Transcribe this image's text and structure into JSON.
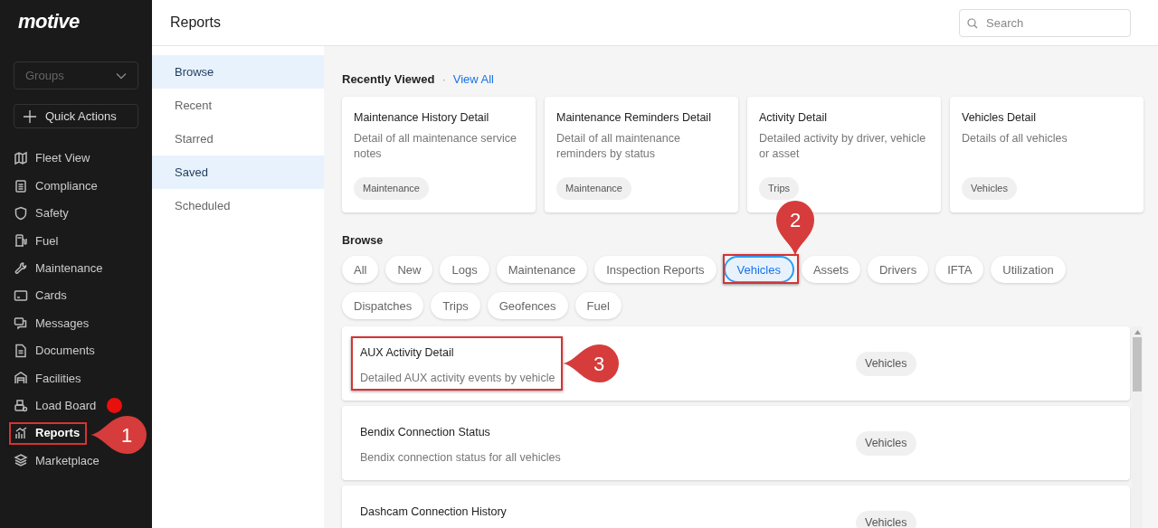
{
  "sidebar": {
    "logo": "motive",
    "groups": {
      "placeholder": "Groups"
    },
    "quick_actions": "Quick Actions",
    "items": [
      {
        "label": "Fleet View",
        "selected": false,
        "badge": false
      },
      {
        "label": "Compliance",
        "selected": false,
        "badge": false
      },
      {
        "label": "Safety",
        "selected": false,
        "badge": false
      },
      {
        "label": "Fuel",
        "selected": false,
        "badge": false
      },
      {
        "label": "Maintenance",
        "selected": false,
        "badge": false
      },
      {
        "label": "Cards",
        "selected": false,
        "badge": false
      },
      {
        "label": "Messages",
        "selected": false,
        "badge": false
      },
      {
        "label": "Documents",
        "selected": false,
        "badge": false
      },
      {
        "label": "Facilities",
        "selected": false,
        "badge": false
      },
      {
        "label": "Load Board",
        "selected": false,
        "badge": true
      },
      {
        "label": "Reports",
        "selected": true,
        "badge": false
      },
      {
        "label": "Marketplace",
        "selected": false,
        "badge": false
      }
    ]
  },
  "header": {
    "title": "Reports",
    "search": {
      "placeholder": "Search"
    }
  },
  "subnav": [
    {
      "label": "Browse",
      "selected": true
    },
    {
      "label": "Recent",
      "selected": false
    },
    {
      "label": "Starred",
      "selected": false
    },
    {
      "label": "Saved",
      "selected": true
    },
    {
      "label": "Scheduled",
      "selected": false
    }
  ],
  "recently_viewed": {
    "title": "Recently Viewed",
    "separator": "·",
    "link": "View All",
    "cards": [
      {
        "title": "Maintenance History Detail",
        "description": "Detail of all maintenance service notes",
        "tag": "Maintenance"
      },
      {
        "title": "Maintenance Reminders Detail",
        "description": "Detail of all maintenance reminders by status",
        "tag": "Maintenance"
      },
      {
        "title": "Activity Detail",
        "description": "Detailed activity by driver, vehicle or asset",
        "tag": "Trips"
      },
      {
        "title": "Vehicles Detail",
        "description": "Details of all vehicles",
        "tag": "Vehicles"
      }
    ]
  },
  "browse": {
    "title": "Browse",
    "filters": [
      {
        "label": "All",
        "selected": false
      },
      {
        "label": "New",
        "selected": false
      },
      {
        "label": "Logs",
        "selected": false
      },
      {
        "label": "Maintenance",
        "selected": false
      },
      {
        "label": "Inspection Reports",
        "selected": false
      },
      {
        "label": "Vehicles",
        "selected": true
      },
      {
        "label": "Assets",
        "selected": false
      },
      {
        "label": "Drivers",
        "selected": false
      },
      {
        "label": "IFTA",
        "selected": false
      },
      {
        "label": "Utilization",
        "selected": false
      },
      {
        "label": "Dispatches",
        "selected": false
      },
      {
        "label": "Trips",
        "selected": false
      },
      {
        "label": "Geofences",
        "selected": false
      },
      {
        "label": "Fuel",
        "selected": false
      }
    ],
    "reports": [
      {
        "title": "AUX Activity Detail",
        "description": "Detailed AUX activity events by vehicle",
        "tag": "Vehicles"
      },
      {
        "title": "Bendix Connection Status",
        "description": "Bendix connection status for all vehicles",
        "tag": "Vehicles"
      },
      {
        "title": "Dashcam Connection History",
        "tag": "Vehicles"
      }
    ]
  },
  "callouts": [
    {
      "number": "1"
    },
    {
      "number": "2"
    },
    {
      "number": "3"
    }
  ]
}
